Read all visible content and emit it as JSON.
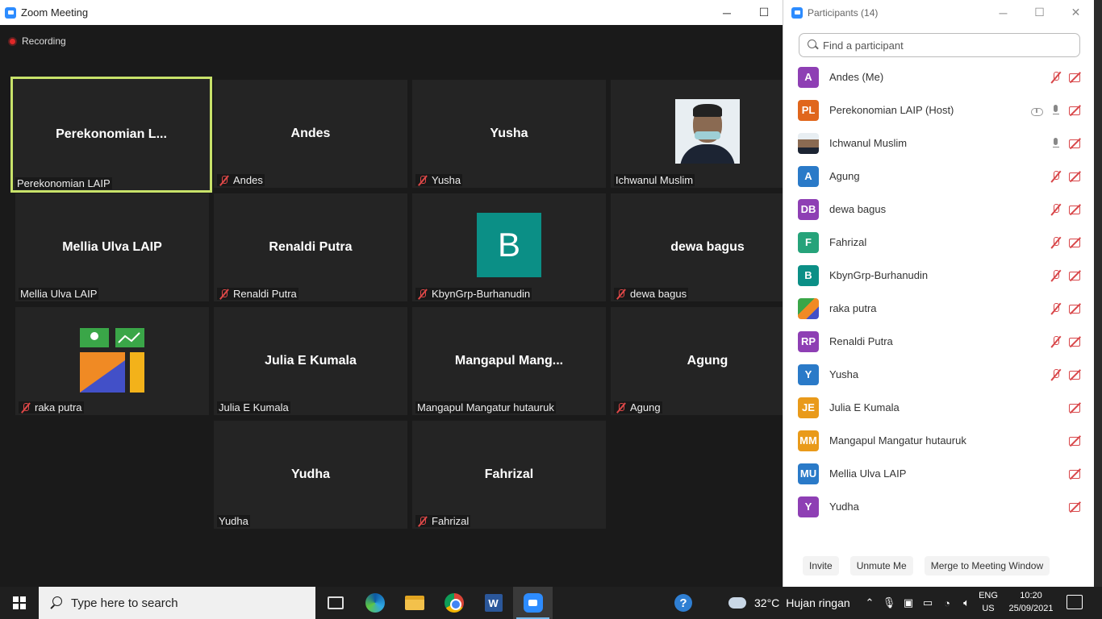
{
  "zoom_window": {
    "title": "Zoom Meeting",
    "recording_label": "Recording",
    "controls": {
      "minimize": "─",
      "maximize": "☐",
      "close": "✕"
    }
  },
  "tiles": [
    {
      "name": "Perekonomian  L...",
      "label": "Perekonomian LAIP",
      "muted": false,
      "active": true,
      "kind": "name"
    },
    {
      "name": "Andes",
      "label": "Andes",
      "muted": true,
      "kind": "name"
    },
    {
      "name": "Yusha",
      "label": "Yusha",
      "muted": true,
      "kind": "name"
    },
    {
      "name": "",
      "label": "Ichwanul Muslim",
      "muted": false,
      "kind": "photo"
    },
    {
      "name": "Mellia Ulva LAIP",
      "label": "Mellia Ulva LAIP",
      "muted": false,
      "kind": "name"
    },
    {
      "name": "Renaldi Putra",
      "label": "Renaldi Putra",
      "muted": true,
      "kind": "name"
    },
    {
      "name": "B",
      "label": "KbynGrp-Burhanudin",
      "muted": true,
      "kind": "avatar"
    },
    {
      "name": "dewa bagus",
      "label": "dewa bagus",
      "muted": true,
      "kind": "name"
    },
    {
      "name": "",
      "label": "raka putra",
      "muted": true,
      "kind": "picture"
    },
    {
      "name": "Julia E Kumala",
      "label": "Julia E Kumala",
      "muted": false,
      "kind": "name"
    },
    {
      "name": "Mangapul  Mang...",
      "label": "Mangapul Mangatur hutauruk",
      "muted": false,
      "kind": "name"
    },
    {
      "name": "Agung",
      "label": "Agung",
      "muted": true,
      "kind": "name"
    },
    {
      "name": "Yudha",
      "label": "Yudha",
      "muted": false,
      "kind": "name"
    },
    {
      "name": "Fahrizal",
      "label": "Fahrizal",
      "muted": true,
      "kind": "name"
    }
  ],
  "participants_panel": {
    "title": "Participants (14)",
    "search_placeholder": "Find a participant",
    "participants": [
      {
        "initials": "A",
        "name": "Andes (Me)",
        "color": "#8e3fb4",
        "mic": "off",
        "cam": "off"
      },
      {
        "initials": "PL",
        "name": "Perekonomian LAIP (Host)",
        "color": "#e0661c",
        "mic": "on",
        "cam": "off",
        "cloud": true
      },
      {
        "initials": "",
        "name": "Ichwanul Muslim",
        "color": "#5a7ea8",
        "mic": "on",
        "cam": "off",
        "photo": true
      },
      {
        "initials": "A",
        "name": "Agung",
        "color": "#2a7ac8",
        "mic": "off",
        "cam": "off"
      },
      {
        "initials": "DB",
        "name": "dewa bagus",
        "color": "#8e3fb4",
        "mic": "off",
        "cam": "off"
      },
      {
        "initials": "F",
        "name": "Fahrizal",
        "color": "#26a37a",
        "mic": "off",
        "cam": "off"
      },
      {
        "initials": "B",
        "name": "KbynGrp-Burhanudin",
        "color": "#0b8f86",
        "mic": "off",
        "cam": "off"
      },
      {
        "initials": "",
        "name": "raka putra",
        "color": "#3a8a3a",
        "mic": "off",
        "cam": "off",
        "photo": true
      },
      {
        "initials": "RP",
        "name": "Renaldi Putra",
        "color": "#8e3fb4",
        "mic": "off",
        "cam": "off"
      },
      {
        "initials": "Y",
        "name": "Yusha",
        "color": "#2a7ac8",
        "mic": "off",
        "cam": "off"
      },
      {
        "initials": "JE",
        "name": "Julia E Kumala",
        "color": "#e99a1a",
        "mic": "none",
        "cam": "off"
      },
      {
        "initials": "MM",
        "name": "Mangapul Mangatur hutauruk",
        "color": "#e99a1a",
        "mic": "none",
        "cam": "off"
      },
      {
        "initials": "MU",
        "name": "Mellia Ulva LAIP",
        "color": "#2a7ac8",
        "mic": "none",
        "cam": "off"
      },
      {
        "initials": "Y",
        "name": "Yudha",
        "color": "#8e3fb4",
        "mic": "none",
        "cam": "off"
      }
    ],
    "buttons": {
      "invite": "Invite",
      "unmute": "Unmute Me",
      "merge": "Merge to Meeting Window"
    }
  },
  "taskbar": {
    "search_placeholder": "Type here to search",
    "apps": [
      "task-view-icon",
      "edge-icon",
      "file-explorer-icon",
      "chrome-icon",
      "word-icon",
      "zoom-icon"
    ],
    "weather": {
      "temp": "32°C",
      "desc": "Hujan ringan"
    },
    "language": {
      "line1": "ENG",
      "line2": "US"
    },
    "clock": {
      "time": "10:20",
      "date": "25/09/2021"
    }
  }
}
